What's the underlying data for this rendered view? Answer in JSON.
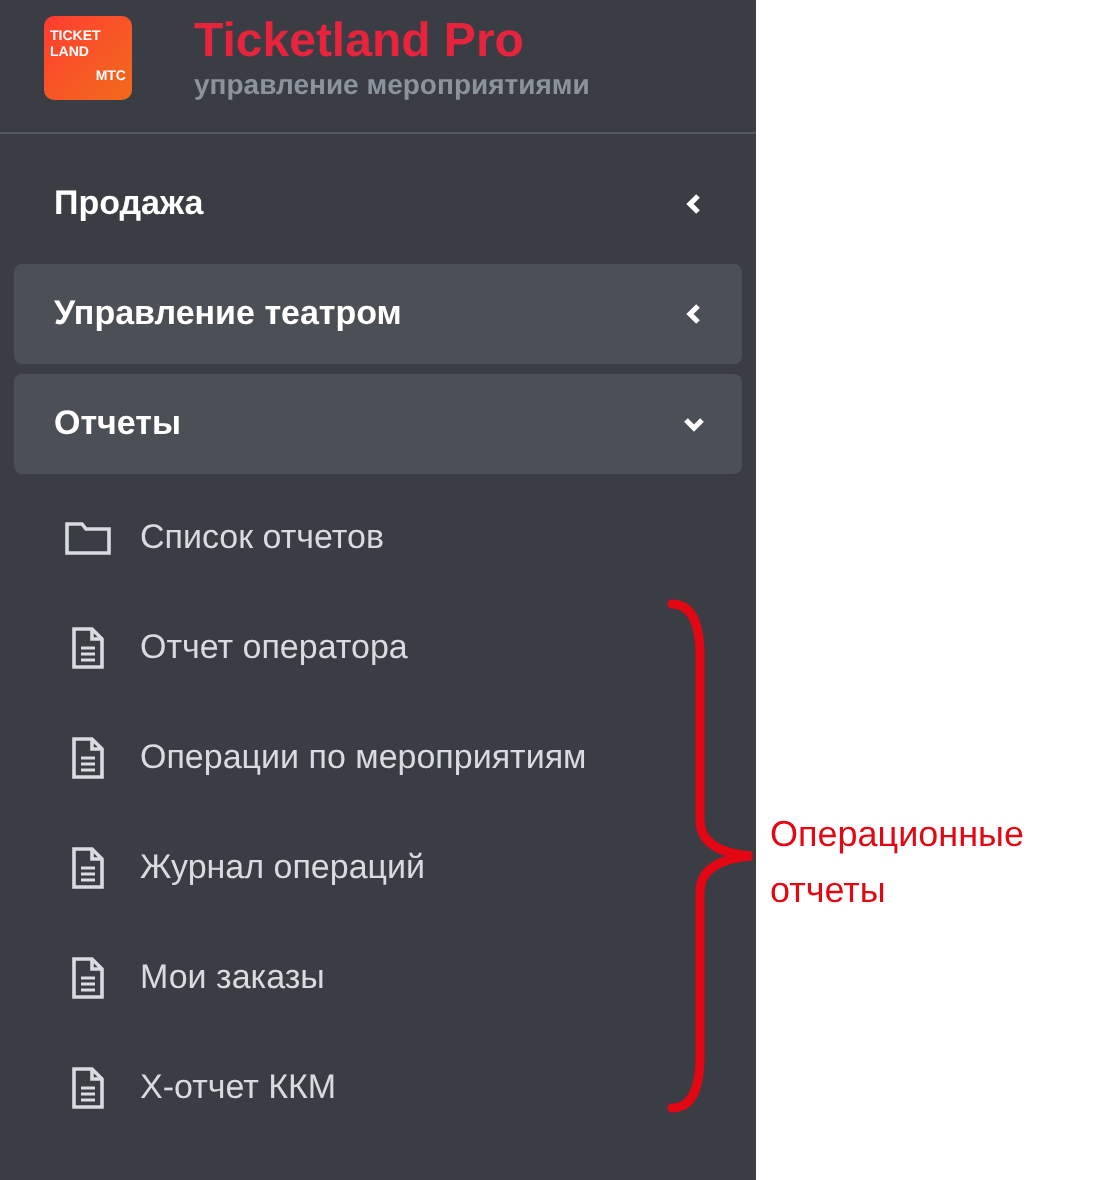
{
  "logo": {
    "lines": [
      "TICKET",
      "LAND",
      "МТС"
    ]
  },
  "brand": {
    "title": "Ticketland Pro",
    "subtitle": "управление мероприятиями"
  },
  "sections": [
    {
      "label": "Продажа",
      "active": false,
      "expanded": false
    },
    {
      "label": "Управление театром",
      "active": true,
      "expanded": false
    },
    {
      "label": "Отчеты",
      "active": true,
      "expanded": true,
      "items": [
        {
          "kind": "folder",
          "label": "Список отчетов"
        },
        {
          "kind": "document",
          "label": "Отчет оператора"
        },
        {
          "kind": "document",
          "label": "Операции по мероприятиям"
        },
        {
          "kind": "document",
          "label": "Журнал операций"
        },
        {
          "kind": "document",
          "label": "Мои заказы"
        },
        {
          "kind": "document",
          "label": "X-отчет ККМ"
        }
      ]
    }
  ],
  "annotation": {
    "text": "Операционные отчеты"
  }
}
